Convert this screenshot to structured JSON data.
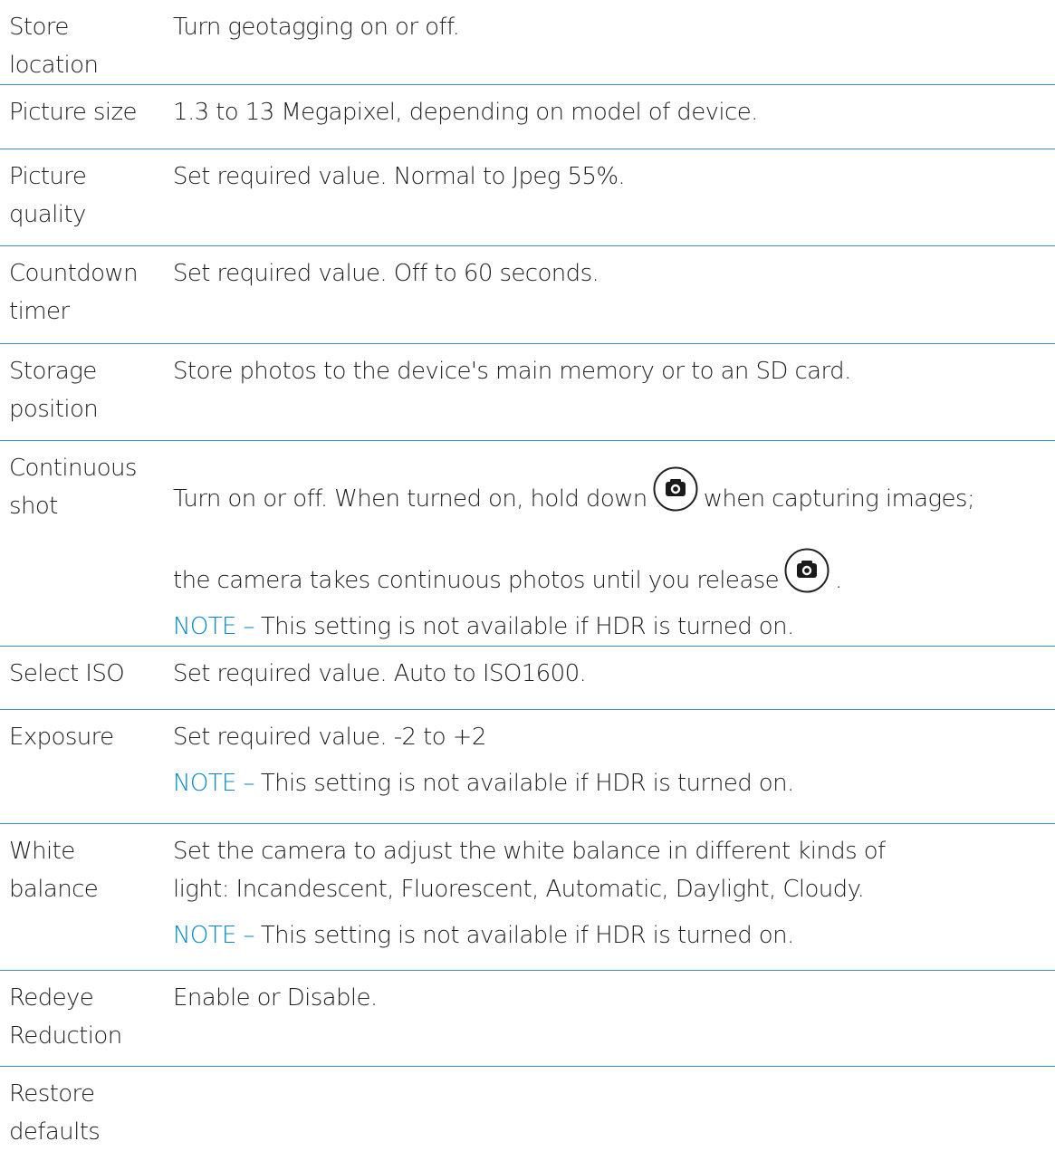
{
  "rows": [
    {
      "label": "Store location",
      "desc": "Turn geotagging on or off."
    },
    {
      "label": "Picture size",
      "desc": "1.3 to 13 Megapixel, depending on model of device."
    },
    {
      "label": "Picture quality",
      "desc": "Set required value. Normal to Jpeg 55%."
    },
    {
      "label": "Countdown timer",
      "desc": "Set required value. Off to 60 seconds."
    },
    {
      "label": "Storage position",
      "desc": "Store photos to the device's main memory or to an SD card."
    },
    {
      "label": "Continuous shot",
      "desc_a": "Turn on or off. When turned on, hold down",
      "desc_b": "when capturing images;",
      "desc_c": "the camera takes continuous photos until you release",
      "desc_d": ".",
      "note": "This setting is not available if HDR is turned on."
    },
    {
      "label": "Select ISO",
      "desc": "Set required value. Auto to ISO1600."
    },
    {
      "label": "Exposure",
      "desc": "Set required value. -2 to +2",
      "note": "This setting is not available if HDR is turned on."
    },
    {
      "label": "White balance",
      "desc_line1": "Set the camera to adjust the white balance in different kinds of",
      "desc_line2": "light: Incandescent, Fluorescent, Automatic, Daylight, Cloudy.",
      "note": "This setting is not available if HDR is turned on."
    },
    {
      "label": "Redeye Reduction",
      "desc": "Enable or Disable."
    },
    {
      "label": "Restore defaults",
      "desc": ""
    }
  ],
  "note_prefix": "NOTE –",
  "icons": {
    "shutter": "camera-shutter-icon"
  },
  "colors": {
    "note_accent": "#0088c9",
    "divider": "#3a8fc7"
  }
}
